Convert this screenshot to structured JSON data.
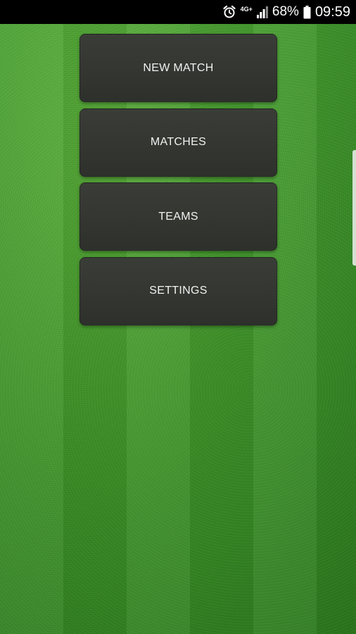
{
  "status_bar": {
    "network_type": "4G+",
    "battery_percent": "68%",
    "clock": "09:59",
    "icons": [
      "alarm-icon",
      "signal-icon",
      "battery-icon"
    ]
  },
  "menu": {
    "items": [
      {
        "label": "NEW MATCH"
      },
      {
        "label": "MATCHES"
      },
      {
        "label": "TEAMS"
      },
      {
        "label": "SETTINGS"
      }
    ]
  },
  "colors": {
    "button_bg": "#33352f",
    "button_text": "#f2f2f2",
    "grass": "#3f9a2a",
    "status_bar_bg": "#000000"
  }
}
